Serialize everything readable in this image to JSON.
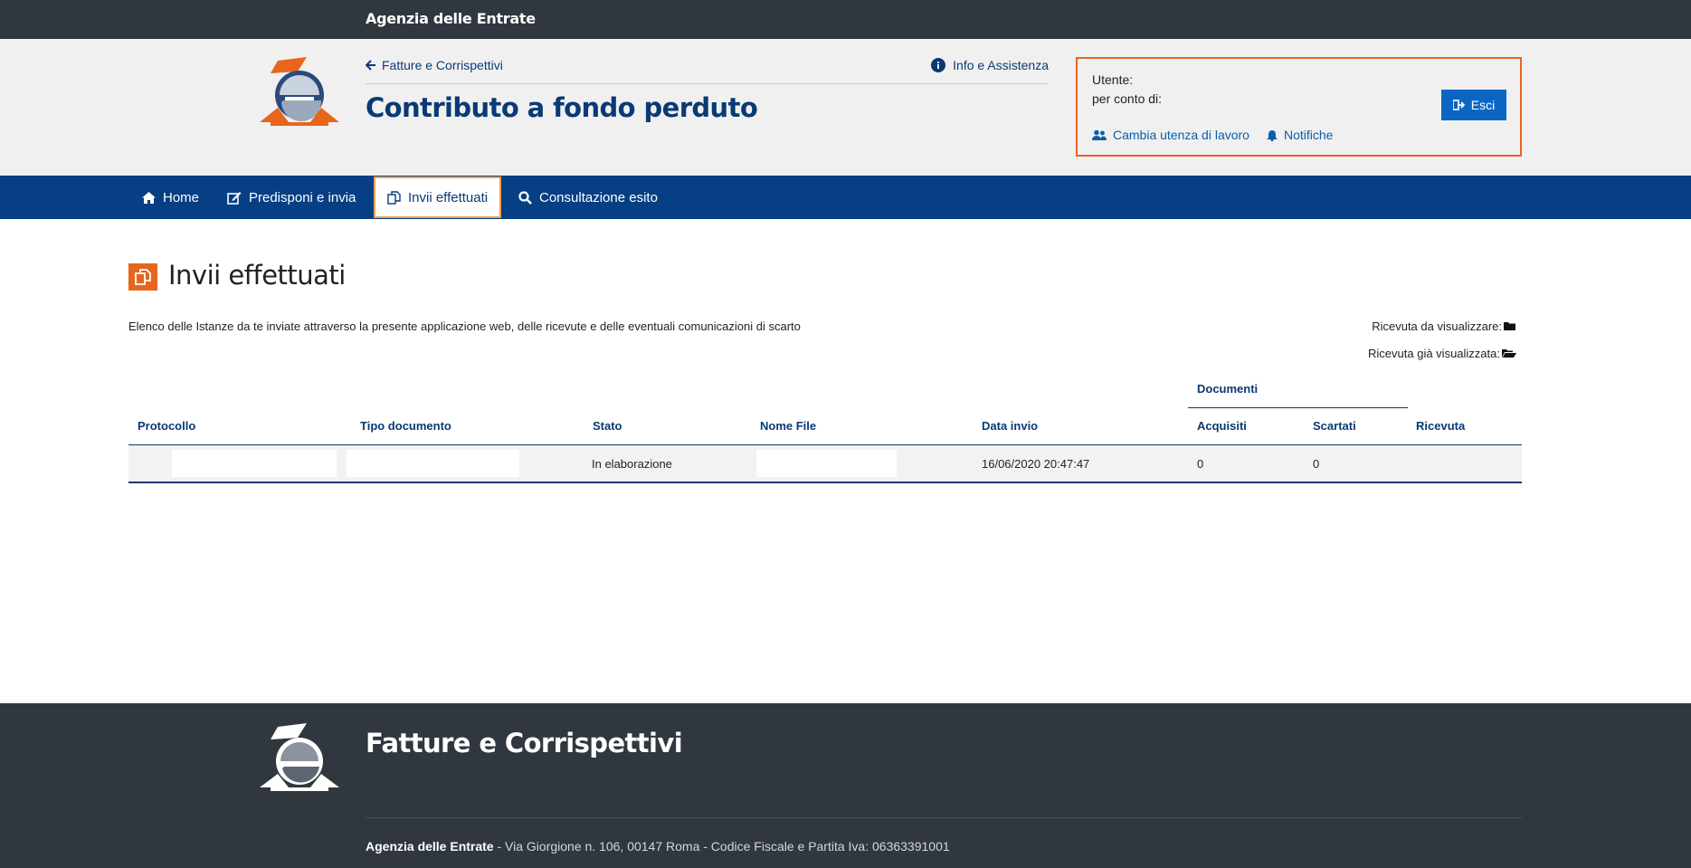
{
  "topbar": {
    "brand": "Agenzia delle Entrate"
  },
  "header": {
    "back_link": "Fatture e Corrispettivi",
    "info_link": "Info e Assistenza",
    "title": "Contributo a fondo perduto"
  },
  "user_box": {
    "utente_label": "Utente:",
    "per_conto_label": "per conto di:",
    "logout_label": "Esci",
    "change_user_label": "Cambia utenza di lavoro",
    "notifications_label": "Notifiche"
  },
  "nav": {
    "items": [
      {
        "label": "Home",
        "icon": "home-icon"
      },
      {
        "label": "Predisponi e invia",
        "icon": "edit-icon"
      },
      {
        "label": "Invii effettuati",
        "icon": "copy-icon"
      },
      {
        "label": "Consultazione esito",
        "icon": "search-icon"
      }
    ],
    "active_index": 2
  },
  "content": {
    "title": "Invii effettuati",
    "description": "Elenco delle Istanze da te inviate attraverso la presente applicazione web, delle ricevute e delle eventuali comunicazioni di scarto",
    "legend_to_view": "Ricevuta da visualizzare:",
    "legend_viewed": "Ricevuta già visualizzata:"
  },
  "table": {
    "group_header": "Documenti",
    "columns": {
      "protocollo": "Protocollo",
      "tipo": "Tipo documento",
      "stato": "Stato",
      "nome_file": "Nome File",
      "data_invio": "Data invio",
      "acquisiti": "Acquisiti",
      "scartati": "Scartati",
      "ricevuta": "Ricevuta"
    },
    "rows": [
      {
        "protocollo": "",
        "tipo": "",
        "stato": "In elaborazione",
        "nome_file": "",
        "data_invio": "16/06/2020 20:47:47",
        "acquisiti": "0",
        "scartati": "0",
        "ricevuta": ""
      }
    ]
  },
  "footer": {
    "title": "Fatture e Corrispettivi",
    "agency": "Agenzia delle Entrate",
    "address": " - Via Giorgione n. 106, 00147 Roma - Codice Fiscale e Partita Iva: 06363391001"
  },
  "colors": {
    "brand_blue": "#063f83",
    "accent_orange": "#e8651c",
    "dark_bar": "#30373f",
    "button_blue": "#0b66c3"
  }
}
